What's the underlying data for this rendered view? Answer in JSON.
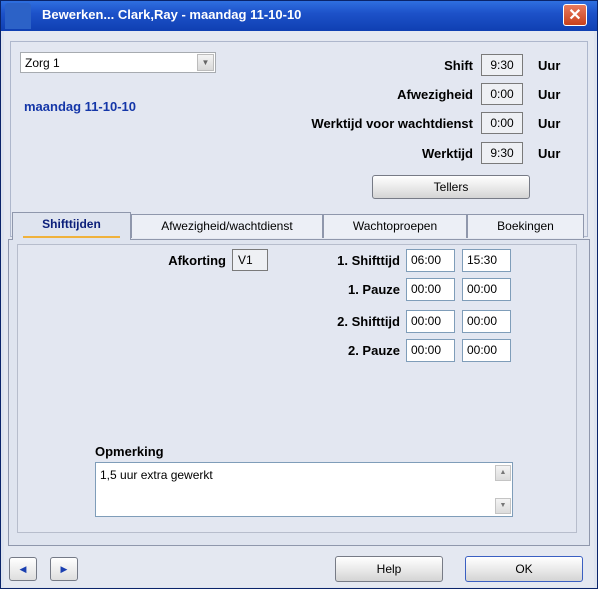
{
  "window": {
    "title": "Bewerken... Clark,Ray - maandag 11-10-10",
    "close_label": "✕"
  },
  "header": {
    "zorg_select": {
      "value": "Zorg 1",
      "arrow": "▼"
    },
    "date_label": "maandag 11-10-10",
    "fields": [
      {
        "label": "Shift",
        "value": "9:30",
        "unit": "Uur"
      },
      {
        "label": "Afwezigheid",
        "value": "0:00",
        "unit": "Uur"
      },
      {
        "label": "Werktijd voor wachtdienst",
        "value": "0:00",
        "unit": "Uur"
      },
      {
        "label": "Werktijd",
        "value": "9:30",
        "unit": "Uur"
      }
    ],
    "tellers_label": "Tellers"
  },
  "tabs": [
    {
      "label": "Shifttijden",
      "active": true
    },
    {
      "label": "Afwezigheid/wachtdienst",
      "active": false
    },
    {
      "label": "Wachtoproepen",
      "active": false
    },
    {
      "label": "Boekingen",
      "active": false
    }
  ],
  "shifttijden": {
    "afkorting_label": "Afkorting",
    "afkorting_value": "V1",
    "rows": [
      {
        "label": "1. Shifttijd",
        "from": "06:00",
        "to": "15:30"
      },
      {
        "label": "1. Pauze",
        "from": "00:00",
        "to": "00:00"
      },
      {
        "label": "2. Shifttijd",
        "from": "00:00",
        "to": "00:00"
      },
      {
        "label": "2. Pauze",
        "from": "00:00",
        "to": "00:00"
      }
    ],
    "opmerking_label": "Opmerking",
    "opmerking_value": "1,5 uur extra gewerkt"
  },
  "footer": {
    "prev": "◀",
    "next": "▶",
    "help_label": "Help",
    "ok_label": "OK"
  },
  "colors": {
    "titlebar": "#1d52c9",
    "date_text": "#1436a8",
    "active_tab_underline": "#f0b23c"
  }
}
